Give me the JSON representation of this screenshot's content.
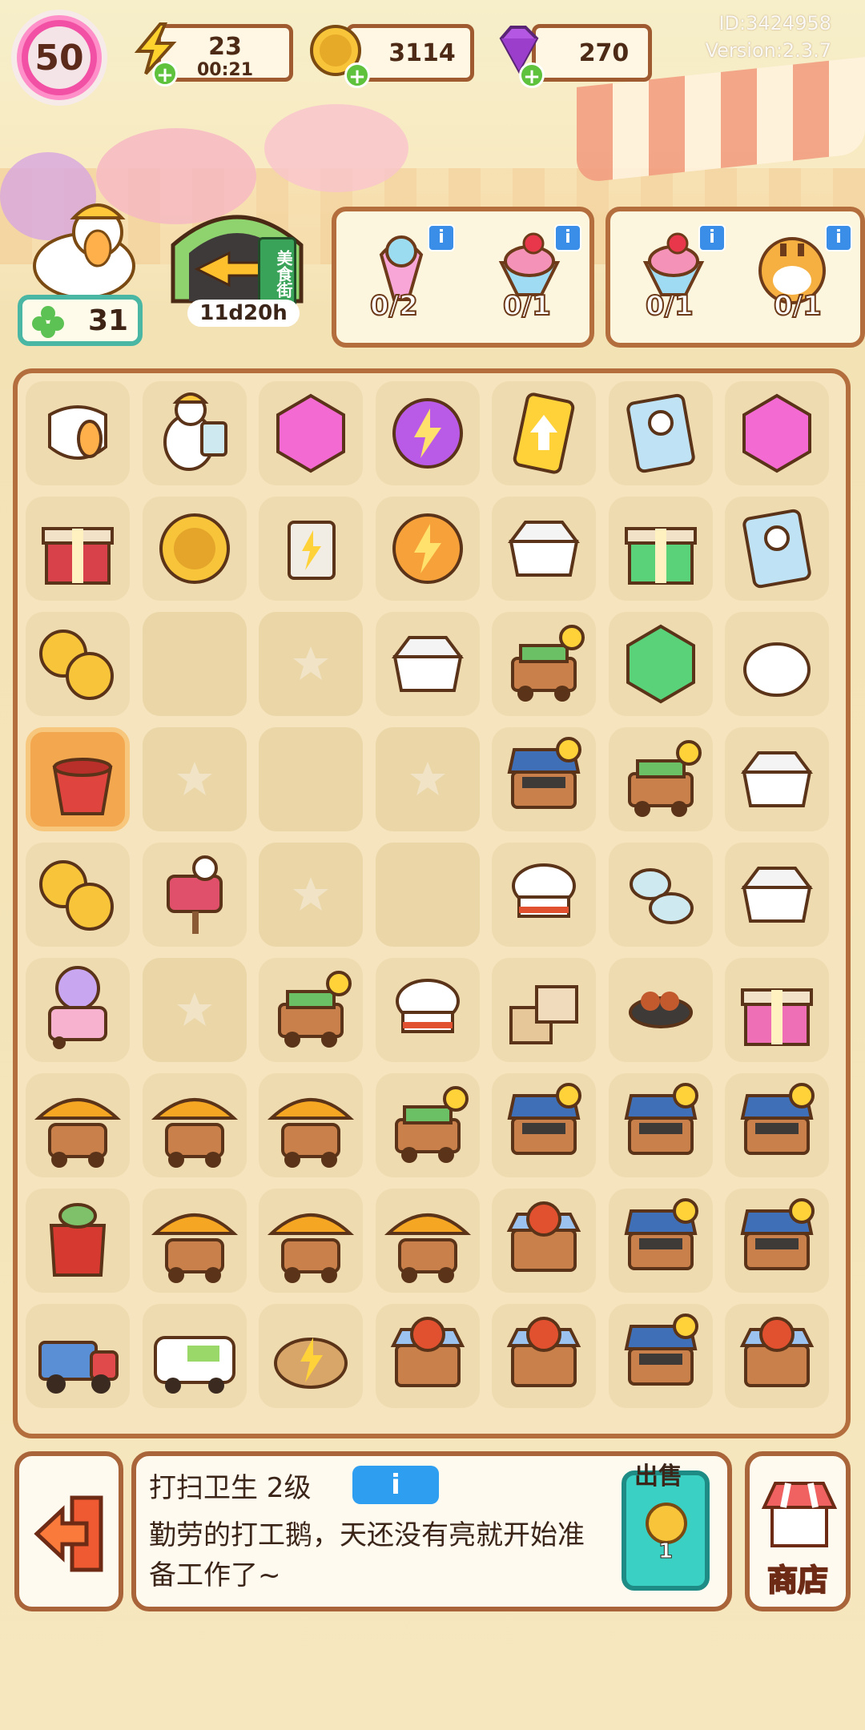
{
  "top_bar": {
    "level": "50",
    "energy": {
      "value": "23",
      "timer": "00:21"
    },
    "coins": {
      "value": "3114"
    },
    "gems": {
      "value": "270"
    },
    "plus_label": "+",
    "id_text": "ID:3424958",
    "version_text": "Version:2.3.7"
  },
  "event": {
    "sign_text": "美食街",
    "timer": "11d20h"
  },
  "clover": {
    "value": "31"
  },
  "orders": [
    {
      "count": "0/2",
      "icon": "ice-cream-icon"
    },
    {
      "count": "0/1",
      "icon": "strawberry-sundae-icon"
    },
    {
      "count": "0/1",
      "icon": "strawberry-sundae-icon"
    },
    {
      "count": "0/1",
      "icon": "tiger-customer-icon"
    }
  ],
  "info_label": "i",
  "board": {
    "rows": [
      [
        "mask-icon",
        "goose-worker-icon",
        "pink-gem-icon",
        "energy-orb-icon",
        "upgrade-card-icon",
        "goose-card-icon",
        "pink-gem-icon"
      ],
      [
        "gift-box-icon",
        "coin-icon",
        "vending-cart-icon",
        "energy-orb-orange-icon",
        "takeout-box-icon",
        "green-gift-icon",
        "goose-card-icon"
      ],
      [
        "coin-stack-icon",
        "empty",
        "star-slot",
        "takeout-box-icon",
        "food-cart-icon",
        "green-gem-icon",
        "bun-icon"
      ],
      [
        "bucket-icon",
        "star-slot",
        "empty",
        "star-slot",
        "grill-stand-icon",
        "food-cart-icon",
        "takeout-box-icon"
      ],
      [
        "coin-stack-icon",
        "goose-sign-icon",
        "star-slot",
        "empty",
        "chef-hat-icon",
        "bowls-icon",
        "takeout-box-icon"
      ],
      [
        "ice-cream-cart-icon",
        "star-slot",
        "food-cart-icon",
        "chef-hat-icon",
        "boxes-icon",
        "bbq-grill-icon",
        "pink-gift-icon"
      ],
      [
        "umbrella-cart-icon",
        "umbrella-cart-icon",
        "umbrella-cart-icon",
        "food-cart-icon",
        "grill-stand-icon",
        "grill-stand-icon",
        "grill-stand-icon"
      ],
      [
        "red-jar-icon",
        "umbrella-cart-icon",
        "umbrella-cart-icon",
        "umbrella-cart-icon",
        "lobster-stand-icon",
        "grill-stand-icon",
        "grill-stand-icon"
      ],
      [
        "delivery-truck-icon",
        "ice-cream-van-icon",
        "bread-basket-icon",
        "lobster-stand-icon",
        "lobster-stand-icon",
        "grill-stand-icon",
        "lobster-stand-icon"
      ]
    ]
  },
  "selection": {
    "title": "打扫卫生 2级",
    "info_label": "i",
    "description": "勤劳的打工鹅，天还没有亮就开始准备工作了~",
    "sell_label": "出售",
    "sell_value": "1"
  },
  "shop_label": "商店",
  "colors": {
    "accent_brown": "#b46e3d",
    "level_pink": "#f250a4",
    "sell_teal": "#3ad0c4",
    "info_blue": "#2d9ef0"
  }
}
